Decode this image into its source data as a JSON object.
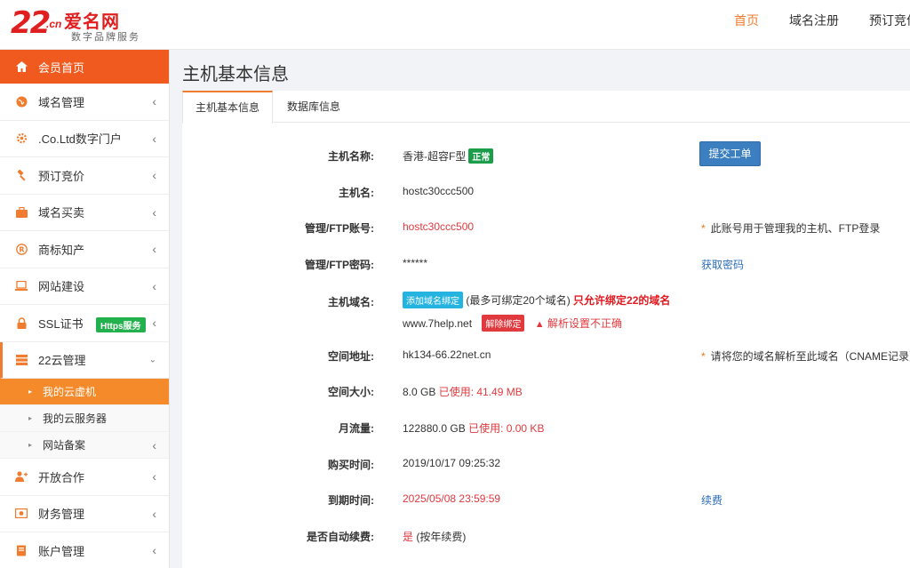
{
  "logo": {
    "num": "22",
    "cn": ".cn",
    "name": "爱名网",
    "sub": "数字品牌服务"
  },
  "topnav": [
    "首页",
    "域名注册",
    "预订竞价"
  ],
  "sidebar": {
    "home": "会员首页",
    "items": [
      {
        "label": "域名管理",
        "icon": "globe-icon"
      },
      {
        "label": ".Co.Ltd数字门户",
        "icon": "gear-icon"
      },
      {
        "label": "预订竞价",
        "icon": "gavel-icon"
      },
      {
        "label": "域名买卖",
        "icon": "briefcase-icon"
      },
      {
        "label": "商标知产",
        "icon": "registered-icon"
      },
      {
        "label": "网站建设",
        "icon": "laptop-icon"
      },
      {
        "label": "SSL证书",
        "icon": "lock-icon",
        "badge": "Https服务"
      },
      {
        "label": "22云管理",
        "icon": "server-icon"
      }
    ],
    "sub_items": [
      "我的云虚机",
      "我的云服务器",
      "网站备案"
    ],
    "items_after": [
      {
        "label": "开放合作",
        "icon": "users-icon"
      },
      {
        "label": "财务管理",
        "icon": "money-icon"
      },
      {
        "label": "账户管理",
        "icon": "book-icon"
      }
    ]
  },
  "page_title": "主机基本信息",
  "tabs": [
    "主机基本信息",
    "数据库信息"
  ],
  "fields": {
    "host_name": {
      "label": "主机名称:",
      "value": "香港-超容F型",
      "badge": "正常"
    },
    "host_id": {
      "label": "主机名:",
      "value": "hostc30ccc500"
    },
    "ftp_account": {
      "label": "管理/FTP账号:",
      "value": "hostc30ccc500",
      "note": "此账号用于管理我的主机、FTP登录"
    },
    "ftp_password": {
      "label": "管理/FTP密码:",
      "value": "******",
      "link": "获取密码"
    },
    "domain": {
      "label": "主机域名:",
      "bind_btn": "添加域名绑定",
      "bind_hint": "(最多可绑定20个域名)",
      "bind_warn": "只允许绑定22的域名",
      "bound": "www.7help.net",
      "unbind_btn": "解除绑定",
      "resolve_warn": "解析设置不正确"
    },
    "space_addr": {
      "label": "空间地址:",
      "value": "hk134-66.22net.cn",
      "note": "请将您的域名解析至此域名（CNAME记录）"
    },
    "space_size": {
      "label": "空间大小:",
      "value": "8.0 GB",
      "used": "已使用: 41.49 MB"
    },
    "traffic": {
      "label": "月流量:",
      "value": "122880.0 GB",
      "used": "已使用: 0.00 KB"
    },
    "buy_time": {
      "label": "购买时间:",
      "value": "2019/10/17 09:25:32"
    },
    "expire_time": {
      "label": "到期时间:",
      "value": "2025/05/08 23:59:59",
      "link": "续费"
    },
    "auto_renew": {
      "label": "是否自动续费:",
      "value": "是",
      "suffix": "(按年续费)"
    }
  },
  "submit_ticket": "提交工单"
}
